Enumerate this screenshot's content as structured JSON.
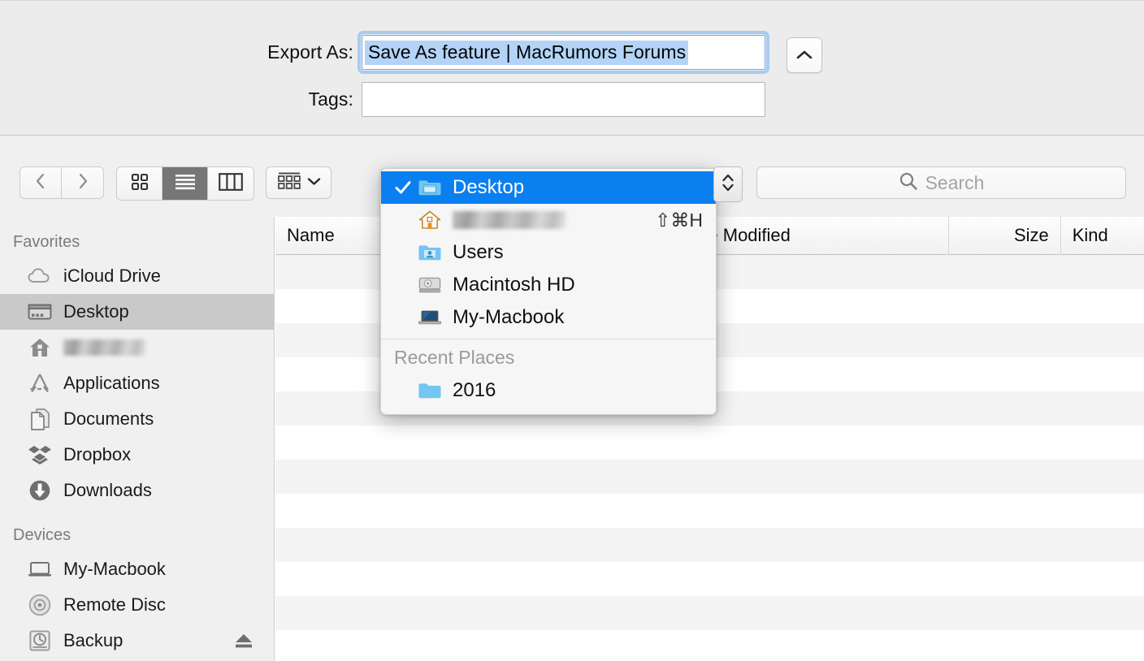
{
  "form": {
    "export_label": "Export As:",
    "export_value": "Save As feature | MacRumors Forums",
    "tags_label": "Tags:",
    "tags_value": "",
    "tags_placeholder": "",
    "disclosure_icon": "chevron-up-icon"
  },
  "toolbar": {
    "back_icon": "chevron-left-icon",
    "forward_icon": "chevron-right-icon",
    "view_modes": [
      {
        "name": "icon-view",
        "icon": "grid-icon",
        "active": false
      },
      {
        "name": "list-view",
        "icon": "list-icon",
        "active": true
      },
      {
        "name": "column-view",
        "icon": "columns-icon",
        "active": false
      }
    ],
    "arrange_icon": "arrange-grid-icon",
    "arrange_caret": "chevron-down-icon"
  },
  "search": {
    "icon": "search-icon",
    "placeholder": "Search",
    "value": ""
  },
  "sidebar": {
    "groups": [
      {
        "title": "Favorites",
        "items": [
          {
            "label": "iCloud Drive",
            "icon": "cloud-icon",
            "selected": false,
            "redacted": false,
            "eject": false
          },
          {
            "label": "Desktop",
            "icon": "desktop-icon",
            "selected": true,
            "redacted": false,
            "eject": false
          },
          {
            "label": "",
            "icon": "home-icon",
            "selected": false,
            "redacted": true,
            "eject": false
          },
          {
            "label": "Applications",
            "icon": "appstore-icon",
            "selected": false,
            "redacted": false,
            "eject": false
          },
          {
            "label": "Documents",
            "icon": "documents-icon",
            "selected": false,
            "redacted": false,
            "eject": false
          },
          {
            "label": "Dropbox",
            "icon": "dropbox-icon",
            "selected": false,
            "redacted": false,
            "eject": false
          },
          {
            "label": "Downloads",
            "icon": "download-icon",
            "selected": false,
            "redacted": false,
            "eject": false
          }
        ]
      },
      {
        "title": "Devices",
        "items": [
          {
            "label": "My-Macbook",
            "icon": "laptop-icon",
            "selected": false,
            "redacted": false,
            "eject": false
          },
          {
            "label": "Remote Disc",
            "icon": "disc-icon",
            "selected": false,
            "redacted": false,
            "eject": false
          },
          {
            "label": "Backup",
            "icon": "timemachine-icon",
            "selected": false,
            "redacted": false,
            "eject": true
          }
        ]
      }
    ]
  },
  "filelist": {
    "columns": [
      {
        "label": "Name",
        "sorted": true
      },
      {
        "label": "Date Modified",
        "sorted": false
      },
      {
        "label": "Size",
        "sorted": false
      },
      {
        "label": "Kind",
        "sorted": false
      }
    ],
    "sort_icon": "chevron-up-icon",
    "rows": []
  },
  "popup": {
    "stepper_icon": "stepper-up-down-icon",
    "items": [
      {
        "label": "Desktop",
        "icon": "folder-desktop-icon",
        "checked": true,
        "highlight": true,
        "shortcut": "",
        "redacted": false
      },
      {
        "label": "",
        "icon": "home-icon-color",
        "checked": false,
        "highlight": false,
        "shortcut": "⇧⌘H",
        "redacted": true
      },
      {
        "label": "Users",
        "icon": "folder-users-icon",
        "checked": false,
        "highlight": false,
        "shortcut": "",
        "redacted": false
      },
      {
        "label": "Macintosh HD",
        "icon": "harddisk-icon",
        "checked": false,
        "highlight": false,
        "shortcut": "",
        "redacted": false
      },
      {
        "label": "My-Macbook",
        "icon": "laptop-color-icon",
        "checked": false,
        "highlight": false,
        "shortcut": "",
        "redacted": false
      }
    ],
    "recent_title": "Recent Places",
    "recent_items": [
      {
        "label": "2016",
        "icon": "folder-icon",
        "checked": false,
        "highlight": false,
        "shortcut": "",
        "redacted": false
      }
    ]
  },
  "colors": {
    "accent_blue": "#0a7ff0",
    "selection_blue": "#b3d4f7",
    "sidebar_selection": "#c9c9c9",
    "chrome_gray": "#ececec",
    "row_alt": "#f4f4f4"
  }
}
